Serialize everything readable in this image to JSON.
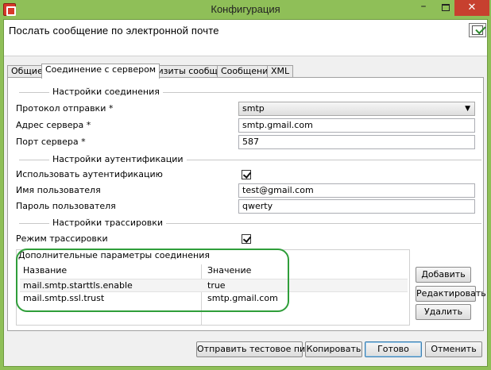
{
  "window": {
    "title": "Конфигурация",
    "minimize_label": "–",
    "close_label": "✕"
  },
  "header": {
    "title": "Послать сообщение по электронной почте"
  },
  "tabs": [
    {
      "label": "Общие",
      "active": false
    },
    {
      "label": "Соединение с сервером",
      "active": true
    },
    {
      "label": "Реквизиты сообщения",
      "active": false
    },
    {
      "label": "Сообщение",
      "active": false
    },
    {
      "label": "XML",
      "active": false
    }
  ],
  "connection": {
    "section_title": "Настройки соединения",
    "protocol_label": "Протокол отправки *",
    "protocol_value": "smtp",
    "server_label": "Адрес сервера *",
    "server_value": "smtp.gmail.com",
    "port_label": "Порт сервера *",
    "port_value": "587"
  },
  "auth": {
    "section_title": "Настройки аутентификации",
    "use_auth_label": "Использовать аутентификацию",
    "use_auth_checked": true,
    "username_label": "Имя пользователя",
    "username_value": "test@gmail.com",
    "password_label": "Пароль пользователя",
    "password_value": "qwerty"
  },
  "trace": {
    "section_title": "Настройки трассировки",
    "mode_label": "Режим трассировки",
    "mode_checked": true
  },
  "params": {
    "title": "Дополнительные параметры соединения",
    "columns": [
      "Название",
      "Значение"
    ],
    "rows": [
      {
        "name": "mail.smtp.starttls.enable",
        "value": "true"
      },
      {
        "name": "mail.smtp.ssl.trust",
        "value": "smtp.gmail.com"
      }
    ],
    "add_label": "Добавить",
    "edit_label": "Редактировать",
    "delete_label": "Удалить"
  },
  "footer": {
    "test_label": "Отправить тестовое письмо",
    "copy_label": "Копировать",
    "ready_label": "Готово",
    "cancel_label": "Отменить"
  },
  "colors": {
    "window_frame": "#8fbf58",
    "close_button": "#c7402f",
    "highlight": "#2f9e3a"
  }
}
